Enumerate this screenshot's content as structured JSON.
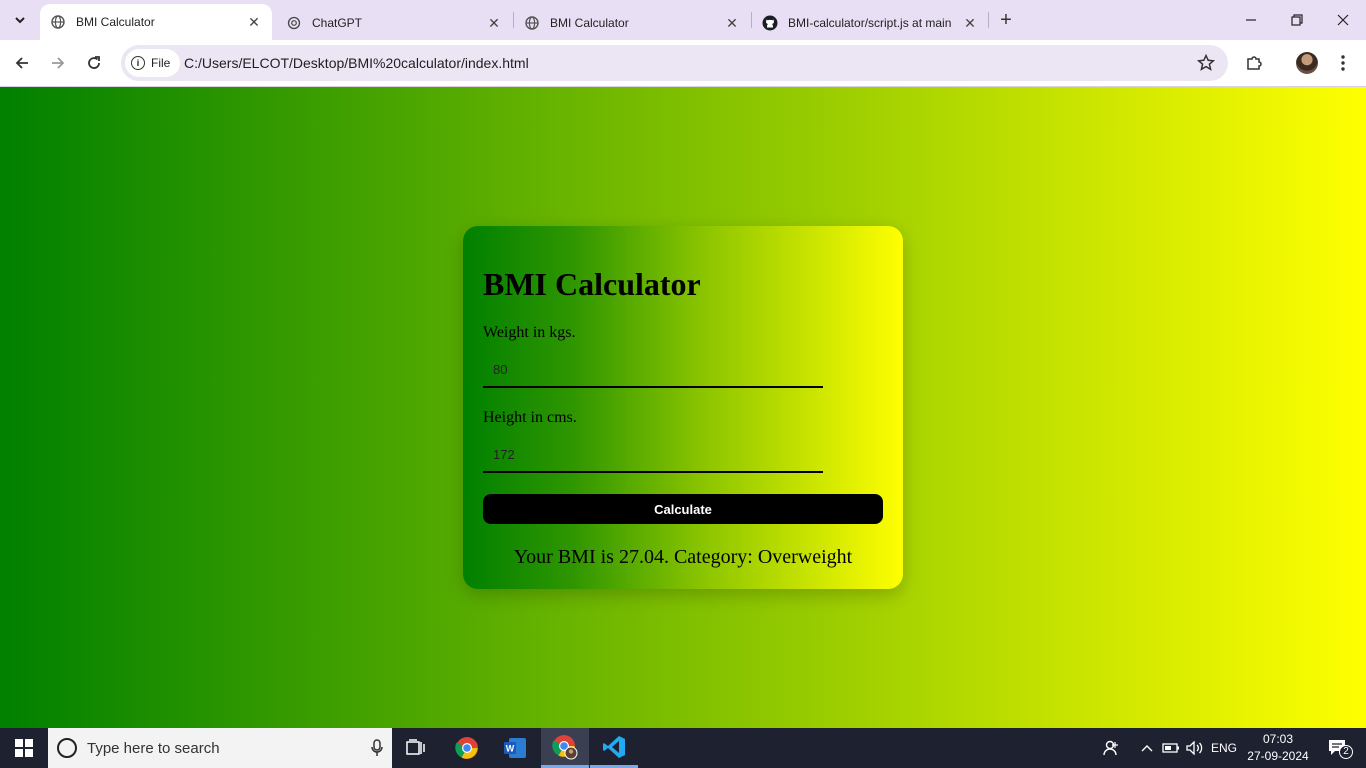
{
  "browser": {
    "tabs": [
      {
        "title": "BMI Calculator",
        "active": true,
        "favicon": "globe-icon"
      },
      {
        "title": "ChatGPT",
        "active": false,
        "favicon": "chatgpt-icon"
      },
      {
        "title": "BMI Calculator",
        "active": false,
        "favicon": "globe-icon"
      },
      {
        "title": "BMI-calculator/script.js at main",
        "active": false,
        "favicon": "github-icon"
      }
    ],
    "site_chip": "File",
    "url": "C:/Users/ELCOT/Desktop/BMI%20calculator/index.html"
  },
  "page": {
    "title": "BMI Calculator",
    "weight_label": "Weight in kgs.",
    "weight_value": "80",
    "height_label": "Height in cms.",
    "height_value": "172",
    "calculate_label": "Calculate",
    "result": "Your BMI is 27.04. Category: Overweight",
    "colors": {
      "gradient_start": "#008000",
      "gradient_end": "#ffff00",
      "button": "#000000"
    }
  },
  "taskbar": {
    "search_placeholder": "Type here to search",
    "language": "ENG",
    "time": "07:03",
    "date": "27-09-2024",
    "notification_count": "2",
    "apps": [
      "task-view-icon",
      "chrome-icon",
      "word-icon",
      "chrome-profile-icon",
      "vscode-icon"
    ]
  }
}
